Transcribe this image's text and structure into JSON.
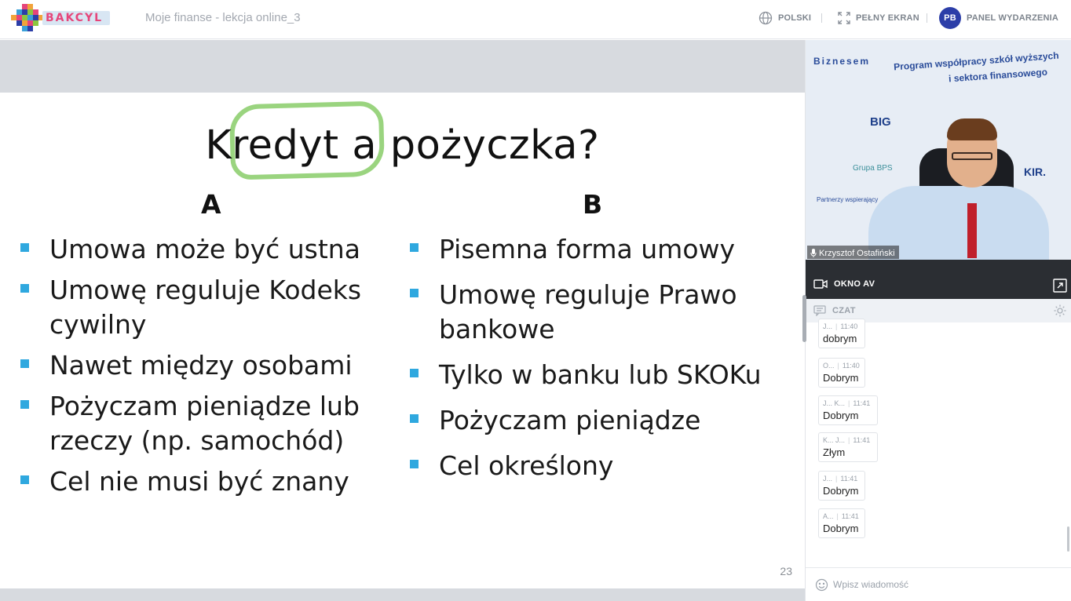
{
  "header": {
    "logo_text": "BAKCYL",
    "session_title": "Moje finanse - lekcja online_3",
    "language_label": "POLSKI",
    "fullscreen_label": "PEŁNY EKRAN",
    "avatar_initials": "PB",
    "event_panel_label": "PANEL WYDARZENIA"
  },
  "slide": {
    "title": "Kredyt a pożyczka?",
    "column_a": {
      "heading": "A",
      "items": [
        "Umowa może być ustna",
        "Umowę reguluje Kodeks cywilny",
        "Nawet między osobami",
        "Pożyczam pieniądze lub rzeczy (np. samochód)",
        "Cel nie musi być znany"
      ]
    },
    "column_b": {
      "heading": "B",
      "items": [
        "Pisemna forma umowy",
        "Umowę reguluje Prawo bankowe",
        "Tylko w banku lub SKOKu",
        "Pożyczam pieniądze",
        "Cel określony"
      ]
    },
    "page_number": "23"
  },
  "video": {
    "banner_left": "Biznesem",
    "banner_right_1": "Program współpracy szkół wyższych",
    "banner_right_2": "i sektora finansowego",
    "partner_big": "BIG",
    "partner_grupa": "Grupa BPS",
    "partner_kir": "KIR.",
    "partner_label": "Partnerzy wspierający",
    "speaker_name": "Krzysztof Ostafiński",
    "av_label": "OKNO AV"
  },
  "chat": {
    "label": "CZAT",
    "composer_placeholder": "Wpisz wiadomość",
    "messages": [
      {
        "author": "J...",
        "time": "11:40",
        "text": "dobrym"
      },
      {
        "author": "O...",
        "time": "11:40",
        "text": "Dobrym"
      },
      {
        "author": "J... K...",
        "time": "11:41",
        "text": "Dobrym"
      },
      {
        "author": "K... J...",
        "time": "11:41",
        "text": "Złym"
      },
      {
        "author": "J...",
        "time": "11:41",
        "text": "Dobrym"
      },
      {
        "author": "A...",
        "time": "11:41",
        "text": "Dobrym"
      }
    ]
  },
  "colors": {
    "accent": "#2c3ea8",
    "bullet": "#2fa8df",
    "highlight": "#8fcf71"
  }
}
